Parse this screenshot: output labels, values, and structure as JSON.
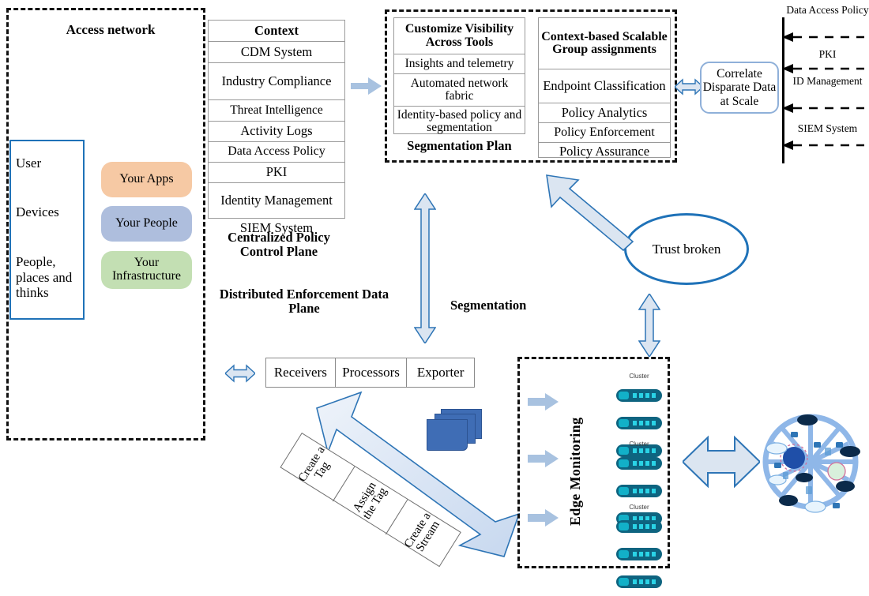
{
  "access_network": {
    "title": "Access network",
    "entity_box": [
      "User",
      "Devices",
      "People, places and thinks"
    ],
    "pills": [
      {
        "label": "Your Apps",
        "color": "#f6c9a4"
      },
      {
        "label": "Your People",
        "color": "#aebedd"
      },
      {
        "label": "Your Infrastructure",
        "color": "#c3dfb3"
      }
    ]
  },
  "context_table": {
    "header": "Context",
    "rows": [
      "CDM System",
      "Industry Compliance",
      "Threat Intelligence",
      "Activity Logs",
      "Data Access Policy",
      "PKI",
      "Identity Management",
      "SIEM System"
    ]
  },
  "planes": {
    "control_plane": "Centralized Policy Control Plane",
    "data_plane": "Distributed Enforcement Data Plane"
  },
  "visibility_table": {
    "header": "Customize Visibility Across Tools",
    "rows": [
      "Insights and telemetry",
      "Automated network fabric",
      "Identity-based policy and segmentation"
    ],
    "caption": "Segmentation Plan"
  },
  "group_table": {
    "header": "Context-based Scalable Group assignments",
    "rows": [
      "Endpoint Classification",
      "Policy Analytics",
      "Policy Enforcement",
      "Policy Assurance"
    ]
  },
  "correlate_box": "Correlate Disparate Data at Scale",
  "right_rail": {
    "items": [
      "Data Access Policy",
      "PKI",
      "ID Management",
      "SIEM System"
    ]
  },
  "trust": {
    "label": "Trust broken"
  },
  "segmentation_label": "Segmentation",
  "pipeline": {
    "cells": [
      "Receivers",
      "Processors",
      "Exporter"
    ]
  },
  "tag_strip": {
    "cells": [
      "Create a Tag",
      "Assign the Tag",
      "Create a Stream"
    ]
  },
  "edge_monitoring": {
    "label": "Edge Monitoring",
    "clusters": [
      "Cluster",
      "Cluster",
      "Cluster"
    ]
  },
  "colors": {
    "accent_blue": "#1f72b8",
    "arrow_fill": "#dbe5f1",
    "arrow_stroke": "#2e75b6",
    "flat_arrow": "#a8c2e0",
    "server_teal": "#0e6480"
  }
}
